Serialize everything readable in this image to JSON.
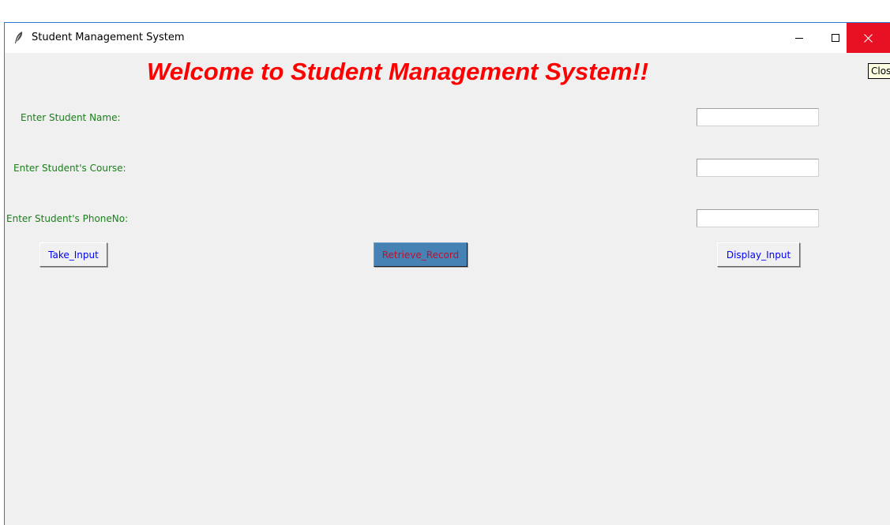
{
  "window": {
    "title": "Student Management System",
    "controls": {
      "minimize_icon": "minimize-icon",
      "maximize_icon": "maximize-icon",
      "close_icon": "close-icon"
    },
    "close_color": "#e81123"
  },
  "heading": {
    "text": "Welcome to Student Management System!!",
    "color": "#ff0000"
  },
  "form": {
    "name_label": "Enter Student Name:",
    "name_value": "",
    "course_label": "Enter Student's Course:",
    "course_value": "",
    "phone_label": "Enter Student's PhoneNo:",
    "phone_value": "",
    "label_color": "#1a7f1a"
  },
  "buttons": {
    "take_input": "Take_Input",
    "retrieve_record": "Retrieve_Record",
    "display_input": "Display_Input",
    "text_color": "#0000ff",
    "retrieve_bg": "#4682b4"
  },
  "tooltip": {
    "text": "Close"
  }
}
